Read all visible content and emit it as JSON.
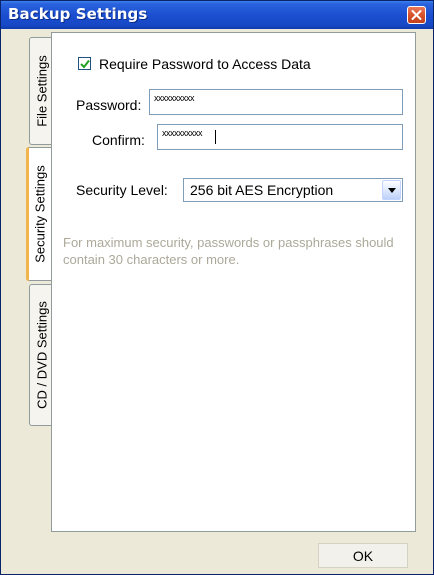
{
  "window": {
    "title": "Backup Settings"
  },
  "tabs": [
    {
      "label": "File Settings"
    },
    {
      "label": "Security Settings"
    },
    {
      "label": "CD / DVD Settings"
    }
  ],
  "security": {
    "require_password_label": "Require Password to Access Data",
    "require_password_checked": true,
    "password_label": "Password:",
    "password_value": "xxxxxxxxxx",
    "confirm_label": "Confirm:",
    "confirm_value": "xxxxxxxxxx",
    "level_label": "Security Level:",
    "level_value": "256 bit AES Encryption",
    "hint": "For maximum security, passwords or passphrases should contain 30 characters or more."
  },
  "buttons": {
    "ok": "OK"
  },
  "icons": {
    "close": "close-icon",
    "checkmark": "checkmark-icon",
    "dropdown": "chevron-down-icon"
  },
  "colors": {
    "titlebar": "#1b4fd0",
    "close": "#d8532b",
    "hint_text": "#aca899",
    "tab_highlight": "#f2b54b"
  }
}
